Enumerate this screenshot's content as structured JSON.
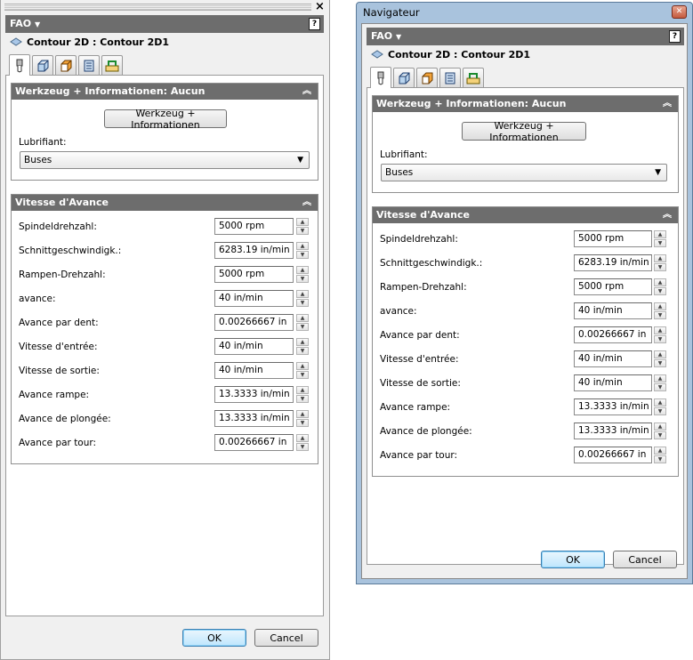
{
  "fao_label": "FAO",
  "help_glyph": "?",
  "close_glyph": "×",
  "contour_title": "Contour 2D : Contour 2D1",
  "section_tool": {
    "title": "Werkzeug + Informationen: Aucun",
    "button": "Werkzeug + Informationen",
    "lubricant_label": "Lubrifiant:",
    "lubricant_value": "Buses"
  },
  "section_feed": {
    "title": "Vitesse d'Avance",
    "rows": [
      {
        "label": "Spindeldrehzahl:",
        "value": "5000 rpm"
      },
      {
        "label": "Schnittgeschwindigk.:",
        "value": "6283.19 in/min"
      },
      {
        "label": "Rampen-Drehzahl:",
        "value": "5000 rpm"
      },
      {
        "label": "avance:",
        "value": "40 in/min"
      },
      {
        "label": "Avance par dent:",
        "value": "0.00266667 in"
      },
      {
        "label": "Vitesse d'entrée:",
        "value": "40 in/min"
      },
      {
        "label": "Vitesse de sortie:",
        "value": "40 in/min"
      },
      {
        "label": "Avance rampe:",
        "value": "13.3333 in/min"
      },
      {
        "label": "Avance de plongée:",
        "value": "13.3333 in/min"
      },
      {
        "label": "Avance par tour:",
        "value": "0.00266667 in"
      }
    ]
  },
  "ok_label": "OK",
  "cancel_label": "Cancel",
  "window_title": "Navigateur",
  "tabs": [
    "tool-tab",
    "geometry-tab",
    "stock-tab",
    "passes-tab",
    "linking-tab"
  ]
}
